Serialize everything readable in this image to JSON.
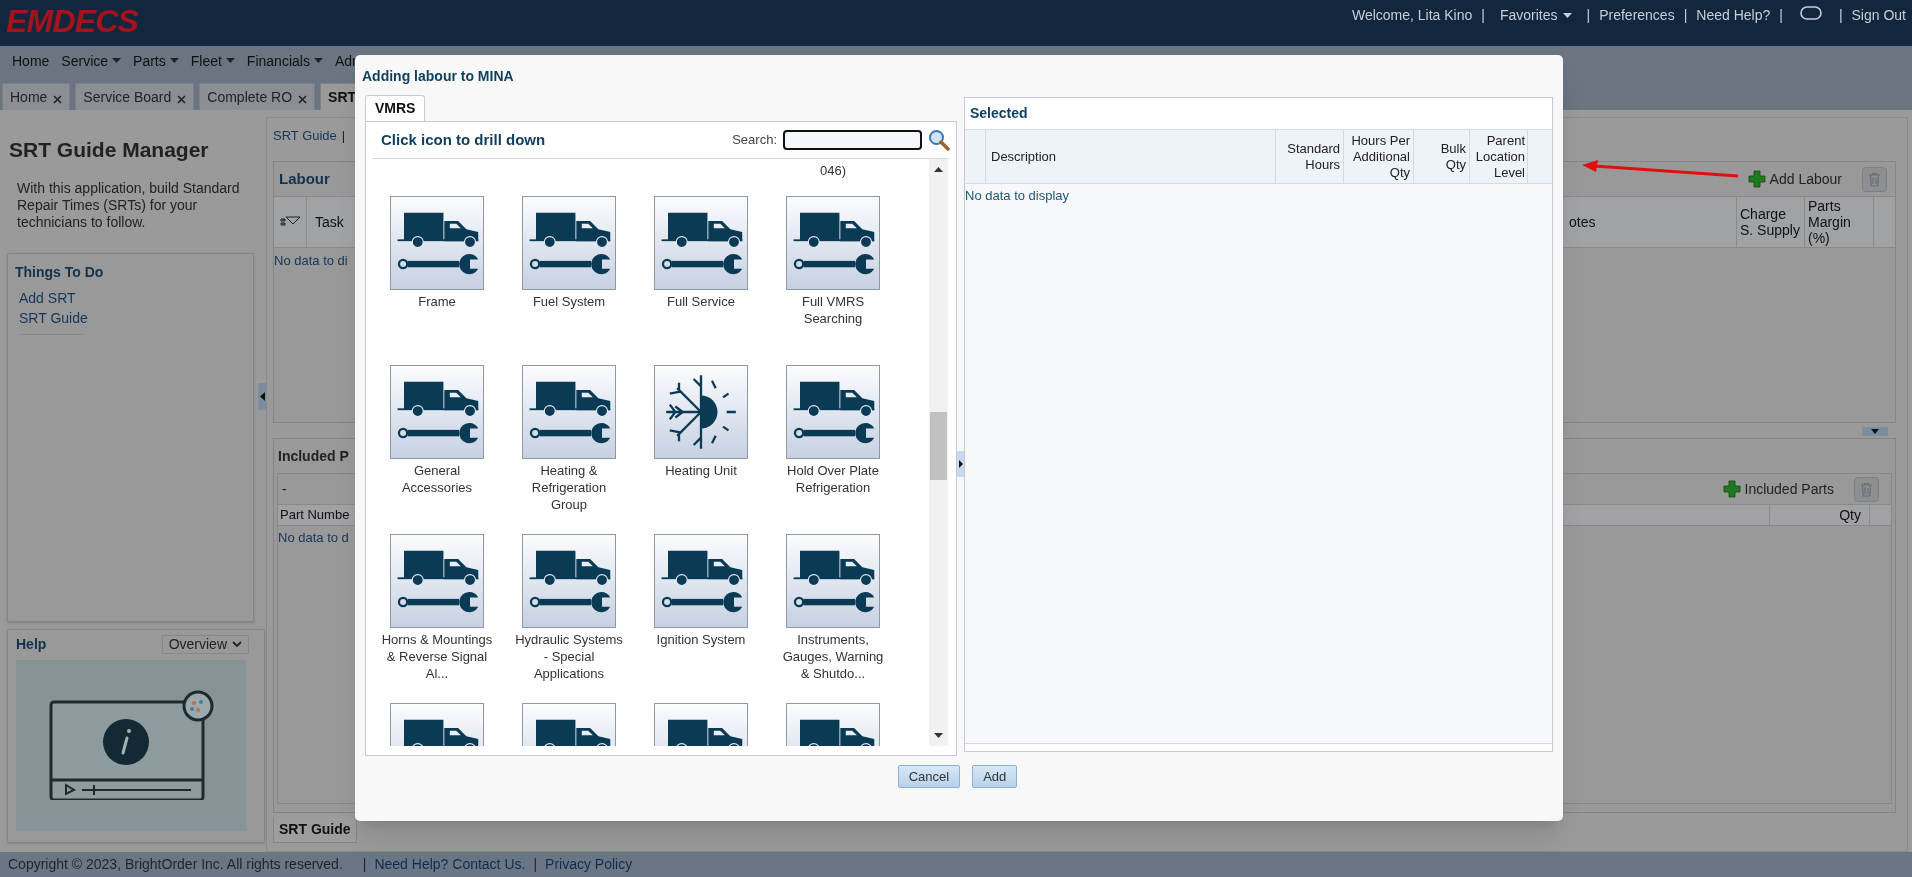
{
  "header": {
    "logo": "EMDECS",
    "separator": "|",
    "links": [
      {
        "kind": "text",
        "label": "Welcome, Lita Kino"
      },
      {
        "kind": "menu",
        "label": "Favorites"
      },
      {
        "kind": "link",
        "label": "Preferences"
      },
      {
        "kind": "link",
        "label": "Need Help?"
      },
      {
        "kind": "icon"
      },
      {
        "kind": "link",
        "label": "Sign Out"
      }
    ]
  },
  "nav": [
    {
      "label": "Home",
      "dropdown": false
    },
    {
      "label": "Service",
      "dropdown": true
    },
    {
      "label": "Parts",
      "dropdown": true
    },
    {
      "label": "Fleet",
      "dropdown": true
    },
    {
      "label": "Financials",
      "dropdown": true
    },
    {
      "label": "Adr",
      "dropdown": false
    }
  ],
  "tabs": [
    {
      "label": "Home",
      "selected": false
    },
    {
      "label": "Service Board",
      "selected": false
    },
    {
      "label": "Complete RO",
      "selected": false
    },
    {
      "label": "SRT",
      "selected": true
    }
  ],
  "sidebar": {
    "title": "SRT Guide Manager",
    "description": "With this application, build Standard Repair Times (SRTs) for your technicians to follow.",
    "things_to_do": {
      "title": "Things To Do",
      "links": [
        "Add SRT",
        "SRT Guide"
      ]
    },
    "help": {
      "title": "Help",
      "dropdown": "Overview"
    }
  },
  "main": {
    "breadcrumb": "SRT Guide",
    "separator": "|",
    "labour": {
      "title": "Labour",
      "columns": [
        "Task",
        "otes",
        "Charge S. Supply",
        "Parts Margin (%)"
      ],
      "empty": "No data to di",
      "add_button": "Add Labour"
    },
    "included": {
      "title": "Included P",
      "subheader": "-",
      "columns": [
        "Part Numbe",
        "Qty"
      ],
      "empty": "No data to d",
      "add_button": "Included Parts"
    },
    "bottom_tab": "SRT Guide"
  },
  "footer": {
    "copyright": "Copyright © 2023, BrightOrder Inc. All rights reserved.",
    "separator": "|",
    "links": [
      "Need Help? Contact Us.",
      "Privacy Policy"
    ]
  },
  "dialog": {
    "title": "Adding labour to MINA",
    "tabs": [
      {
        "label": "VMRS",
        "selected": true
      }
    ],
    "heading": "Click icon to drill down",
    "search": {
      "label": "Search:"
    },
    "overflow_text": "046)",
    "items": [
      {
        "kind": "truck",
        "label": "Frame"
      },
      {
        "kind": "truck",
        "label": "Fuel System"
      },
      {
        "kind": "truck",
        "label": "Full Service"
      },
      {
        "kind": "truck",
        "label": "Full VMRS Searching"
      },
      {
        "kind": "truck",
        "label": "General Accessories"
      },
      {
        "kind": "truck",
        "label": "Heating & Refrigeration Group"
      },
      {
        "kind": "climate",
        "label": "Heating Unit"
      },
      {
        "kind": "truck",
        "label": "Hold Over Plate Refrigeration"
      },
      {
        "kind": "truck",
        "label": "Horns & Mountings & Reverse Signal Al..."
      },
      {
        "kind": "truck",
        "label": "Hydraulic Systems - Special Applications"
      },
      {
        "kind": "truck",
        "label": "Ignition System"
      },
      {
        "kind": "truck",
        "label": "Instruments, Gauges, Warning & Shutdo..."
      },
      {
        "kind": "truck"
      },
      {
        "kind": "truck"
      },
      {
        "kind": "truck"
      },
      {
        "kind": "truck"
      }
    ],
    "selected": {
      "title": "Selected",
      "columns": [
        "Description",
        "Standard Hours",
        "Hours Per Additional Qty",
        "Bulk Qty",
        "Parent Location Level"
      ],
      "empty": "No data to display"
    },
    "buttons": [
      "Cancel",
      "Add"
    ]
  }
}
